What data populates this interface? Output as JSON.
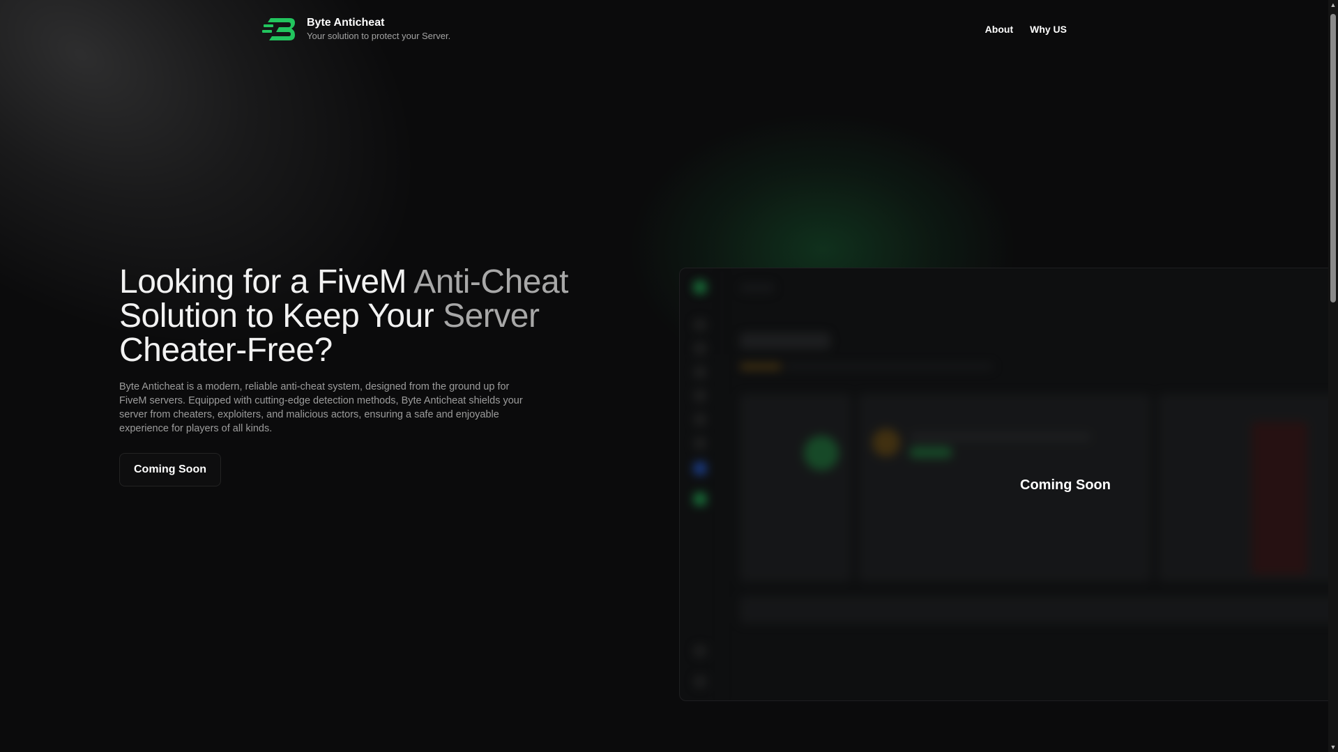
{
  "brand": {
    "name": "Byte Anticheat",
    "tagline": "Your solution to protect your Server.",
    "logo_icon": "byte-logo-icon",
    "accent_color": "#22c55e"
  },
  "nav": {
    "items": [
      {
        "label": "About"
      },
      {
        "label": "Why US"
      }
    ]
  },
  "hero": {
    "title_part1": "Looking for a FiveM ",
    "title_part2": "Anti-Cheat",
    "title_part3": " Solution to Keep Your ",
    "title_part4": "Server",
    "title_part5": " Cheater-Free?",
    "description": "Byte Anticheat is a modern, reliable anti-cheat system, designed from the ground up for FiveM servers. Equipped with cutting-edge detection methods, Byte Anticheat shields your server from cheaters, exploiters, and malicious actors, ensuring a safe and enjoyable experience for players of all kinds.",
    "cta_label": "Coming Soon"
  },
  "preview": {
    "overlay_label": "Coming Soon"
  },
  "scrollbar": {
    "up_icon": "scroll-up-arrow-icon",
    "down_icon": "scroll-down-arrow-icon"
  }
}
